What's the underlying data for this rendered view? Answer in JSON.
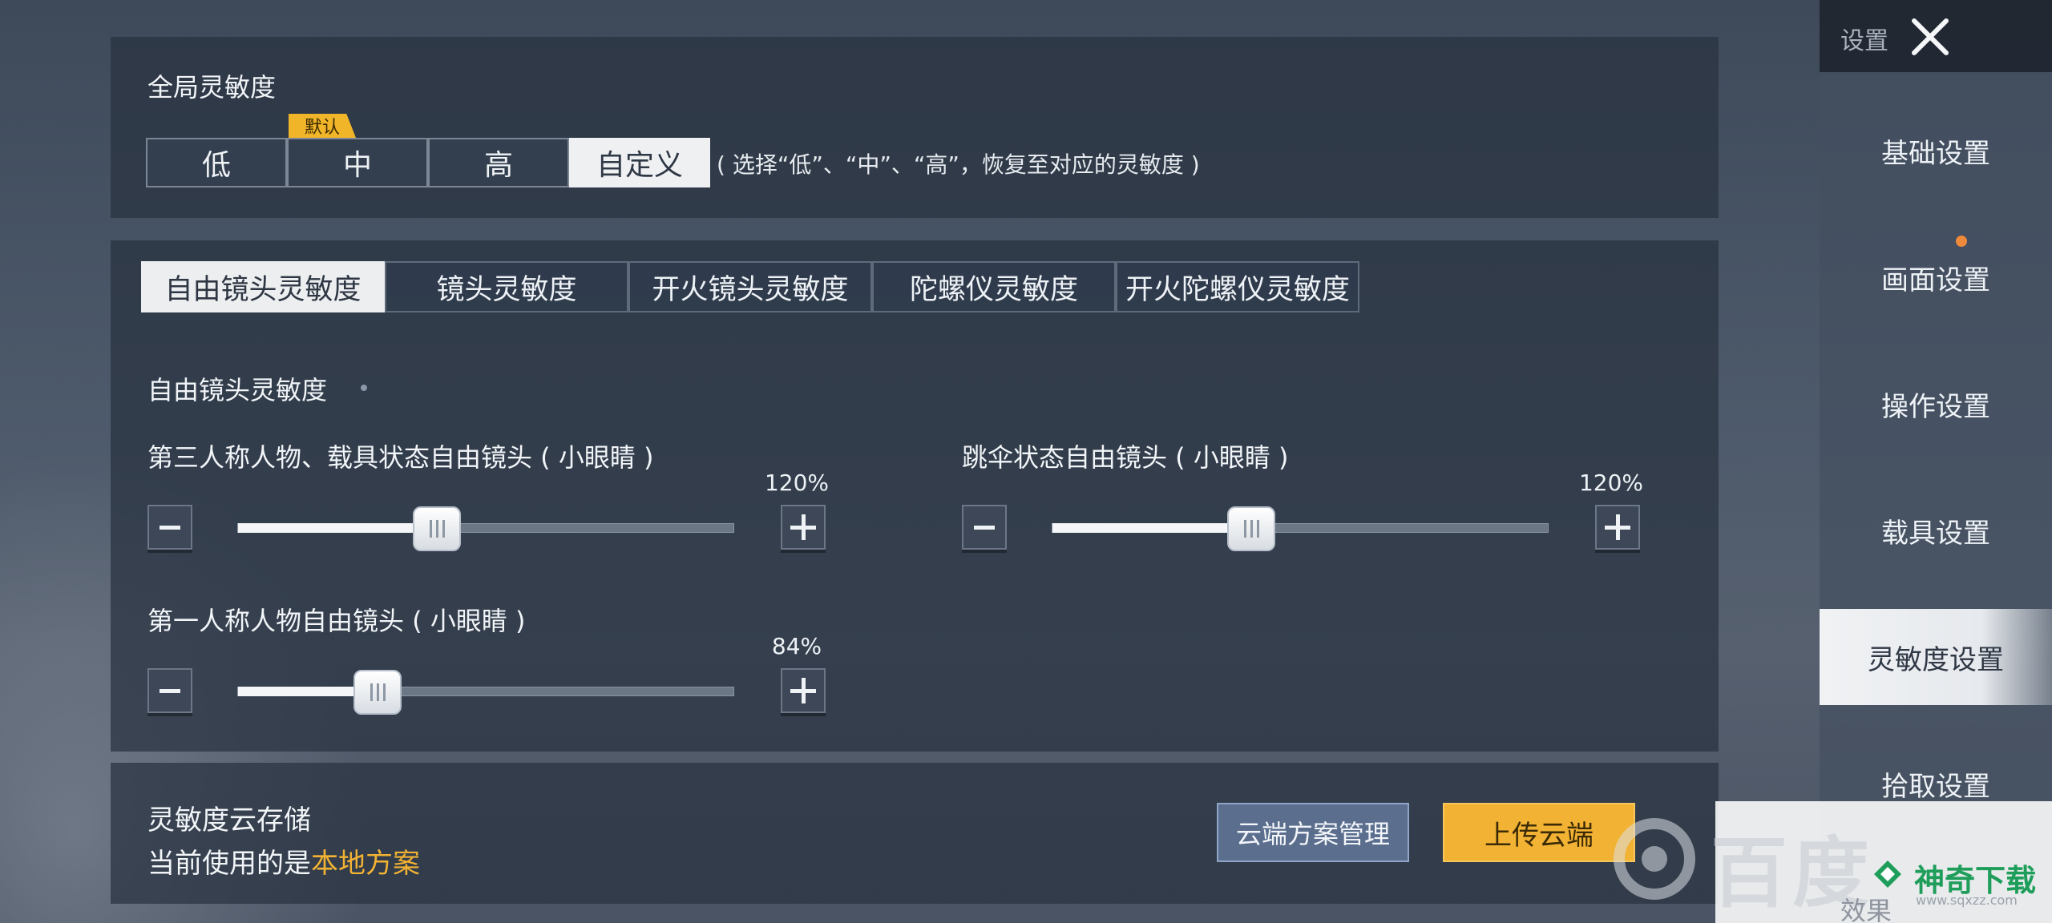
{
  "header": {
    "title": "设置",
    "close_icon": "close-icon"
  },
  "global_sensitivity": {
    "title": "全局灵敏度",
    "default_badge": "默认",
    "options": [
      "低",
      "中",
      "高",
      "自定义"
    ],
    "selected": "自定义",
    "hint": "( 选择“低”、“中”、“高”，恢复至对应的灵敏度 )"
  },
  "tabs": [
    "自由镜头灵敏度",
    "镜头灵敏度",
    "开火镜头灵敏度",
    "陀螺仪灵敏度",
    "开火陀螺仪灵敏度"
  ],
  "active_tab": "自由镜头灵敏度",
  "free_camera": {
    "section_title": "自由镜头灵敏度",
    "sliders": [
      {
        "label": "第三人称人物、载具状态自由镜头 ( 小眼睛 )",
        "value_text": "120%",
        "value": 120,
        "fill_fraction": 0.4
      },
      {
        "label": "跳伞状态自由镜头 ( 小眼睛 )",
        "value_text": "120%",
        "value": 120,
        "fill_fraction": 0.4
      },
      {
        "label": "第一人称人物自由镜头 ( 小眼睛 )",
        "value_text": "84%",
        "value": 84,
        "fill_fraction": 0.28
      }
    ]
  },
  "cloud": {
    "title": "灵敏度云存储",
    "current_prefix": "当前使用的是",
    "current_scheme": "本地方案",
    "manage_button": "云端方案管理",
    "upload_button": "上传云端"
  },
  "sidebar": {
    "items": [
      "基础设置",
      "画面设置",
      "操作设置",
      "载具设置",
      "灵敏度设置",
      "拾取设置",
      "效果"
    ],
    "active": "灵敏度设置"
  },
  "watermarks": {
    "baidu": "百度",
    "site": "神奇下载",
    "site_url": "www.sqxzz.com"
  },
  "colors": {
    "accent": "#f2b233",
    "scheme_highlight": "#f2b233",
    "notice_dot": "#f08a3a"
  }
}
